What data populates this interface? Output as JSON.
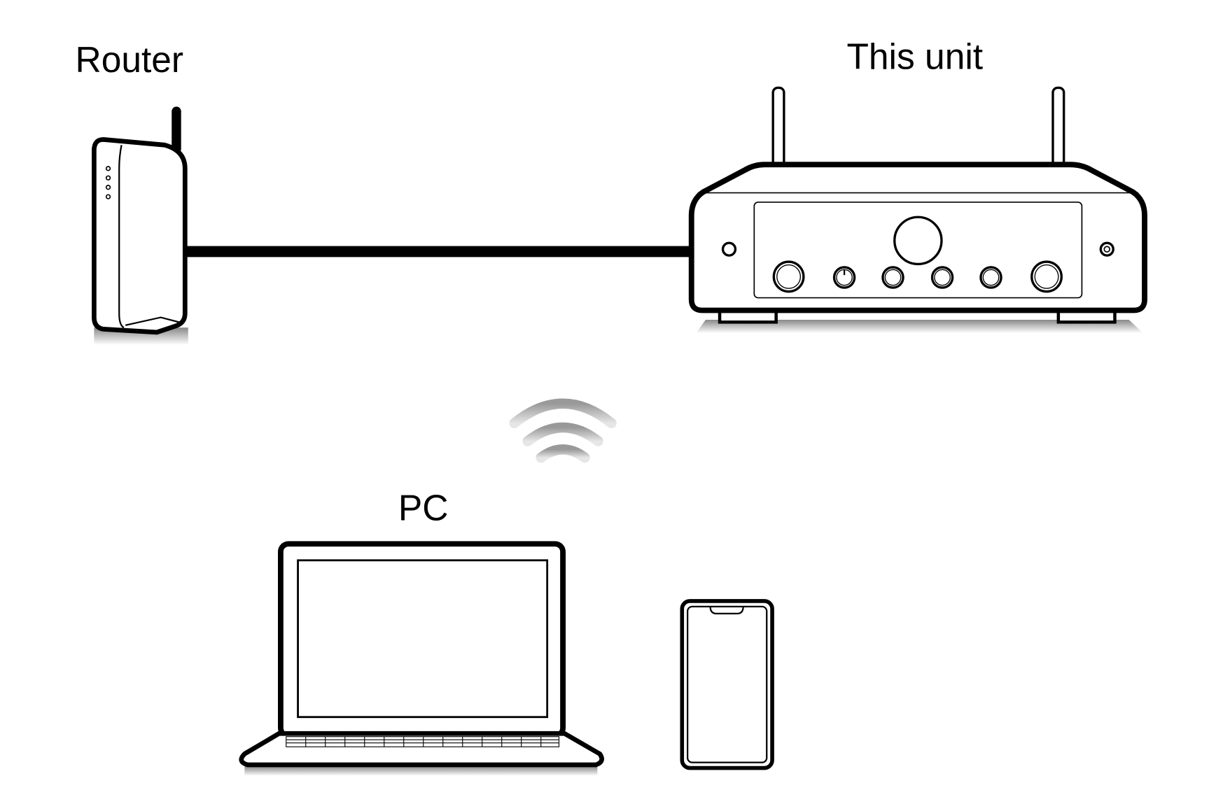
{
  "labels": {
    "router": "Router",
    "unit": "This unit",
    "pc": "PC"
  },
  "connections": [
    {
      "from": "Router",
      "to": "This unit",
      "type": "wired"
    },
    {
      "from": "Router",
      "to": "PC",
      "type": "wireless"
    }
  ],
  "icons": [
    "router-icon",
    "amplifier-icon",
    "wifi-icon",
    "laptop-icon",
    "smartphone-icon"
  ],
  "colors": {
    "stroke": "#000000",
    "wifi": "#b0b0b0",
    "shadow": "#c8c8c8"
  }
}
